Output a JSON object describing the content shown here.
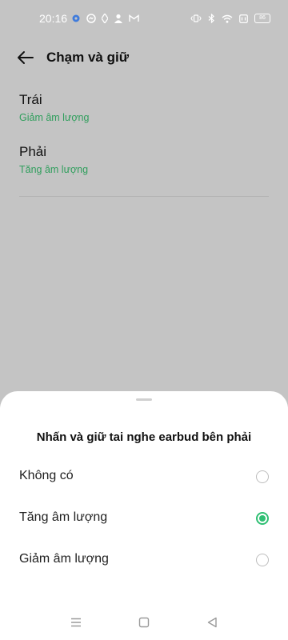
{
  "status_bar": {
    "time": "20:16",
    "battery_label": "86",
    "left_icons": [
      "settings-gear-icon",
      "messenger-icon",
      "diamond-icon",
      "person-icon",
      "gmail-icon"
    ],
    "right_icons": [
      "vibrate-icon",
      "bluetooth-icon",
      "wifi-icon",
      "data-icon",
      "battery-icon"
    ]
  },
  "header": {
    "title": "Chạm và giữ"
  },
  "settings": [
    {
      "label": "Trái",
      "value": "Giảm âm lượng"
    },
    {
      "label": "Phải",
      "value": "Tăng âm lượng"
    }
  ],
  "sheet": {
    "title": "Nhấn và giữ tai nghe earbud bên phải",
    "options": [
      {
        "label": "Không có",
        "selected": false
      },
      {
        "label": "Tăng âm lượng",
        "selected": true
      },
      {
        "label": "Giảm âm lượng",
        "selected": false
      }
    ]
  },
  "colors": {
    "accent": "#2fbf73",
    "value_text": "#2f9e5c",
    "scrim": "#c4c4c4"
  },
  "nav_icons": [
    "menu-icon",
    "home-icon",
    "back-triangle-icon"
  ]
}
